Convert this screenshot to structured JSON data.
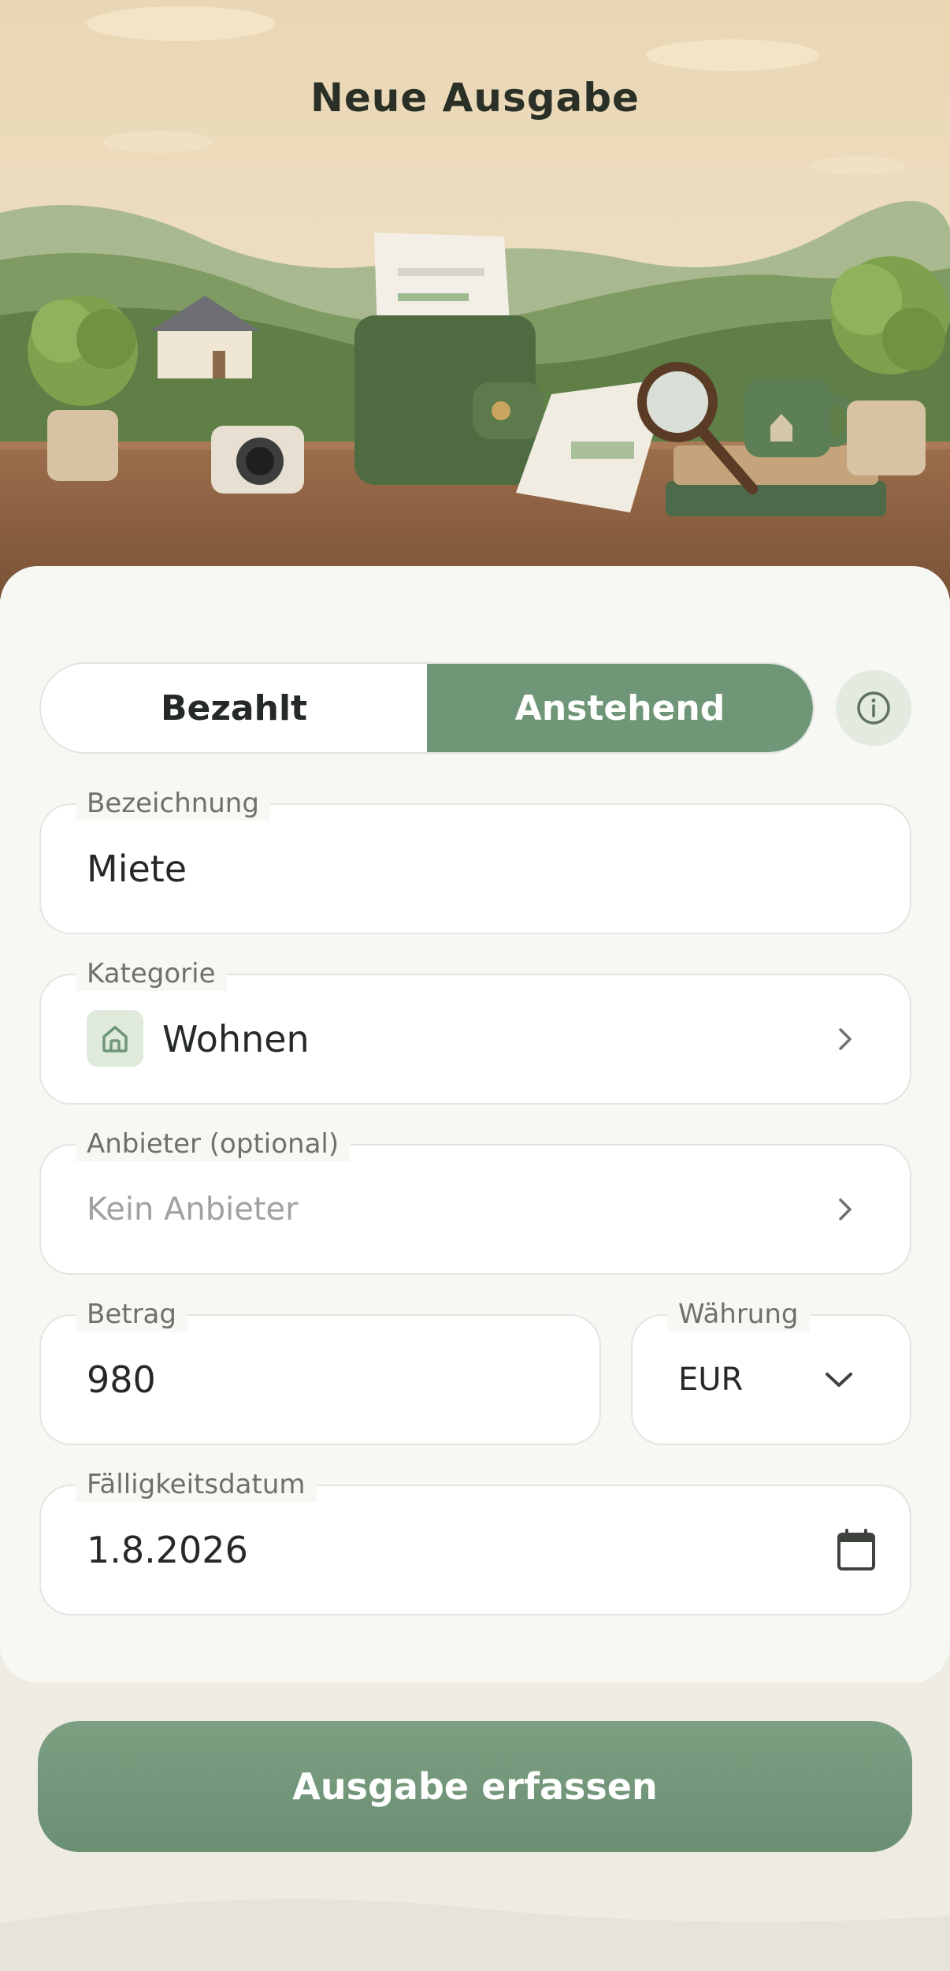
{
  "header": {
    "title": "Neue Ausgabe"
  },
  "status_toggle": {
    "paid_label": "Bezahlt",
    "pending_label": "Anstehend",
    "selected": "Anstehend"
  },
  "form": {
    "name": {
      "label": "Bezeichnung",
      "value": "Miete"
    },
    "category": {
      "label": "Kategorie",
      "value": "Wohnen",
      "icon": "home-icon"
    },
    "provider": {
      "label": "Anbieter (optional)",
      "placeholder": "Kein Anbieter"
    },
    "amount": {
      "label": "Betrag",
      "value": "980"
    },
    "currency": {
      "label": "Währung",
      "value": "EUR"
    },
    "due_date": {
      "label": "Fälligkeitsdatum",
      "value": "1.8.2026",
      "icon": "calendar-icon"
    }
  },
  "submit": {
    "label": "Ausgabe erfassen"
  },
  "colors": {
    "accent": "#6e9677",
    "background": "#eeebe2",
    "card": "#f7f7f3",
    "text": "#262a26"
  }
}
